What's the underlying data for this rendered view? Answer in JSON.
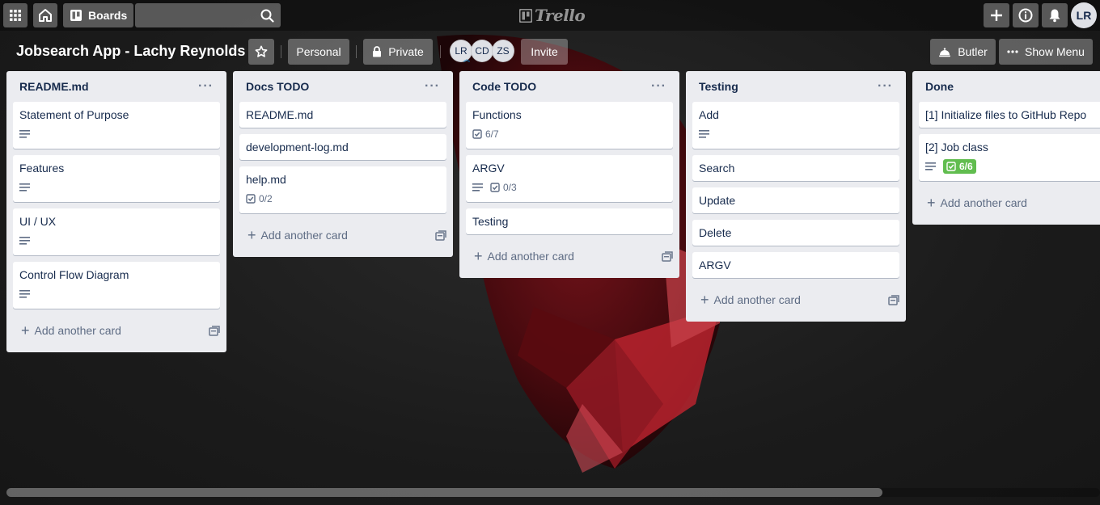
{
  "topbar": {
    "boards_label": "Boards",
    "search_value": "",
    "logo_text": "Trello",
    "avatar_initials": "LR"
  },
  "board": {
    "title": "Jobsearch App - Lachy Reynolds",
    "team_label": "Personal",
    "visibility_label": "Private",
    "members": [
      "LR",
      "CD",
      "ZS"
    ],
    "invite_label": "Invite",
    "butler_label": "Butler",
    "show_menu_label": "Show Menu"
  },
  "add_card_label": "Add another card",
  "lists": [
    {
      "title": "README.md",
      "cards": [
        {
          "title": "Statement of Purpose",
          "description": true
        },
        {
          "title": "Features",
          "description": true
        },
        {
          "title": "UI / UX",
          "description": true
        },
        {
          "title": "Control Flow Diagram",
          "description": true
        }
      ]
    },
    {
      "title": "Docs TODO",
      "cards": [
        {
          "title": "README.md"
        },
        {
          "title": "development-log.md"
        },
        {
          "title": "help.md",
          "checklist": "0/2"
        }
      ]
    },
    {
      "title": "Code TODO",
      "cards": [
        {
          "title": "Functions",
          "checklist": "6/7"
        },
        {
          "title": "ARGV",
          "description": true,
          "checklist": "0/3"
        },
        {
          "title": "Testing"
        }
      ]
    },
    {
      "title": "Testing",
      "cards": [
        {
          "title": "Add",
          "description": true
        },
        {
          "title": "Search"
        },
        {
          "title": "Update"
        },
        {
          "title": "Delete"
        },
        {
          "title": "ARGV"
        }
      ]
    },
    {
      "title": "Done",
      "cards": [
        {
          "title": "[1] Initialize files to GitHub Repo"
        },
        {
          "title": "[2] Job class",
          "description": true,
          "checklist": "6/6",
          "checklist_complete": true
        }
      ]
    }
  ],
  "colors": {
    "list_bg": "#ebecf0",
    "complete_badge": "#61bd4f",
    "text": "#172b4d"
  },
  "horizontal_scroll_fraction": 0.8
}
